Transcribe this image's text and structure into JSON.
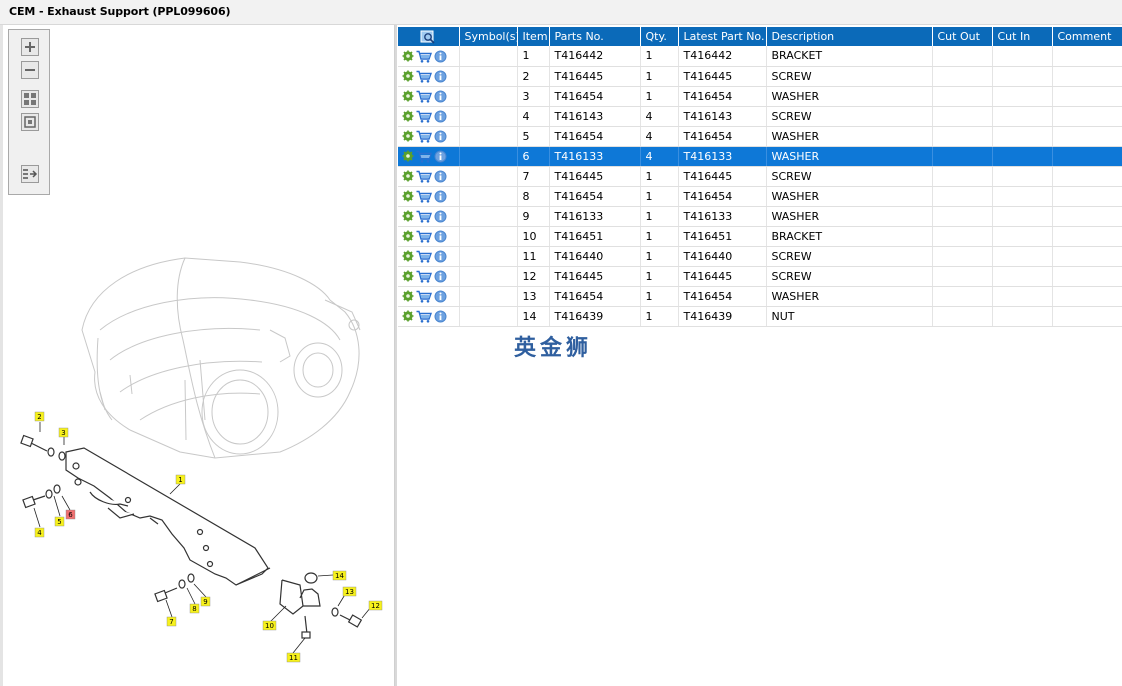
{
  "window": {
    "title": "CEM - Exhaust Support (PPL099606)"
  },
  "toolbox": {
    "buttons": [
      "zoom-in",
      "zoom-out",
      "fit-all",
      "fit-window",
      "panel-export"
    ]
  },
  "diagram": {
    "callouts": [
      {
        "label": "1",
        "color": "#f7f11c"
      },
      {
        "label": "2",
        "color": "#f7f11c"
      },
      {
        "label": "3",
        "color": "#f7f11c"
      },
      {
        "label": "4",
        "color": "#f7f11c"
      },
      {
        "label": "5",
        "color": "#f7f11c"
      },
      {
        "label": "6",
        "color": "#f07070"
      },
      {
        "label": "7",
        "color": "#f7f11c"
      },
      {
        "label": "8",
        "color": "#f7f11c"
      },
      {
        "label": "9",
        "color": "#f7f11c"
      },
      {
        "label": "10",
        "color": "#f7f11c"
      },
      {
        "label": "11",
        "color": "#f7f11c"
      },
      {
        "label": "12",
        "color": "#f7f11c"
      },
      {
        "label": "13",
        "color": "#f7f11c"
      },
      {
        "label": "14",
        "color": "#f7f11c"
      }
    ]
  },
  "table": {
    "columns": [
      "",
      "Symbol(s)",
      "Item",
      "Parts No.",
      "Qty.",
      "Latest Part No.",
      "Description",
      "Cut Out",
      "Cut In",
      "Comment"
    ],
    "selected_index": 5,
    "rows": [
      {
        "symbols": "",
        "item": "1",
        "part_no": "T416442",
        "qty": "1",
        "latest": "T416442",
        "description": "BRACKET",
        "cut_out": "",
        "cut_in": "",
        "comment": ""
      },
      {
        "symbols": "",
        "item": "2",
        "part_no": "T416445",
        "qty": "1",
        "latest": "T416445",
        "description": "SCREW",
        "cut_out": "",
        "cut_in": "",
        "comment": ""
      },
      {
        "symbols": "",
        "item": "3",
        "part_no": "T416454",
        "qty": "1",
        "latest": "T416454",
        "description": "WASHER",
        "cut_out": "",
        "cut_in": "",
        "comment": ""
      },
      {
        "symbols": "",
        "item": "4",
        "part_no": "T416143",
        "qty": "4",
        "latest": "T416143",
        "description": "SCREW",
        "cut_out": "",
        "cut_in": "",
        "comment": ""
      },
      {
        "symbols": "",
        "item": "5",
        "part_no": "T416454",
        "qty": "4",
        "latest": "T416454",
        "description": "WASHER",
        "cut_out": "",
        "cut_in": "",
        "comment": ""
      },
      {
        "symbols": "",
        "item": "6",
        "part_no": "T416133",
        "qty": "4",
        "latest": "T416133",
        "description": "WASHER",
        "cut_out": "",
        "cut_in": "",
        "comment": ""
      },
      {
        "symbols": "",
        "item": "7",
        "part_no": "T416445",
        "qty": "1",
        "latest": "T416445",
        "description": "SCREW",
        "cut_out": "",
        "cut_in": "",
        "comment": ""
      },
      {
        "symbols": "",
        "item": "8",
        "part_no": "T416454",
        "qty": "1",
        "latest": "T416454",
        "description": "WASHER",
        "cut_out": "",
        "cut_in": "",
        "comment": ""
      },
      {
        "symbols": "",
        "item": "9",
        "part_no": "T416133",
        "qty": "1",
        "latest": "T416133",
        "description": "WASHER",
        "cut_out": "",
        "cut_in": "",
        "comment": ""
      },
      {
        "symbols": "",
        "item": "10",
        "part_no": "T416451",
        "qty": "1",
        "latest": "T416451",
        "description": "BRACKET",
        "cut_out": "",
        "cut_in": "",
        "comment": ""
      },
      {
        "symbols": "",
        "item": "11",
        "part_no": "T416440",
        "qty": "1",
        "latest": "T416440",
        "description": "SCREW",
        "cut_out": "",
        "cut_in": "",
        "comment": ""
      },
      {
        "symbols": "",
        "item": "12",
        "part_no": "T416445",
        "qty": "1",
        "latest": "T416445",
        "description": "SCREW",
        "cut_out": "",
        "cut_in": "",
        "comment": ""
      },
      {
        "symbols": "",
        "item": "13",
        "part_no": "T416454",
        "qty": "1",
        "latest": "T416454",
        "description": "WASHER",
        "cut_out": "",
        "cut_in": "",
        "comment": ""
      },
      {
        "symbols": "",
        "item": "14",
        "part_no": "T416439",
        "qty": "1",
        "latest": "T416439",
        "description": "NUT",
        "cut_out": "",
        "cut_in": "",
        "comment": ""
      }
    ]
  },
  "watermark": {
    "text": "英金狮"
  },
  "colors": {
    "header": "#0b6ab9",
    "selected_row": "#0e78d7",
    "callout_yellow": "#f7f11c",
    "callout_red": "#f07070"
  }
}
